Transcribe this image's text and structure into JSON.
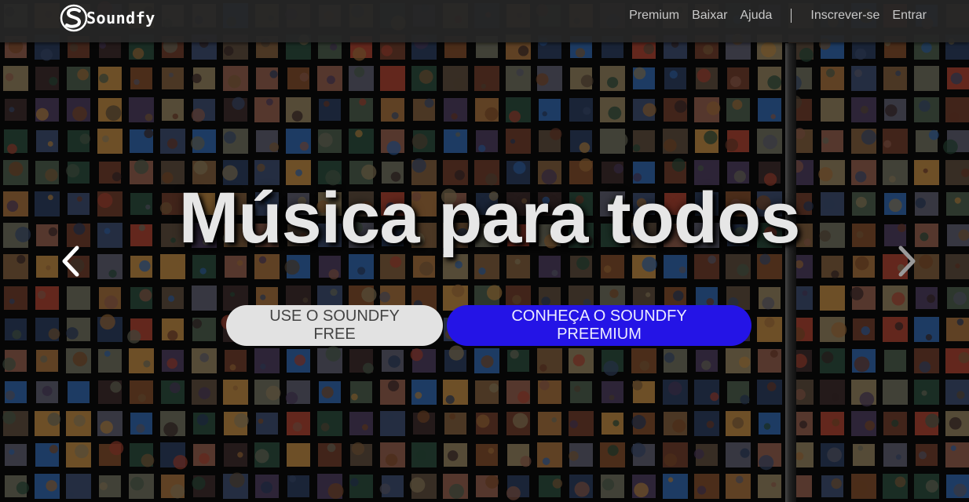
{
  "brand": {
    "name": "Soundfy",
    "logo_icon": "soundfy-s-logo-icon"
  },
  "nav": {
    "links": [
      "Premium",
      "Baixar",
      "Ajuda"
    ],
    "account_links": [
      "Inscrever-se",
      "Entrar"
    ]
  },
  "hero": {
    "title": "Música para todos",
    "free_button": "USE O SOUNDFY FREE",
    "premium_button": "CONHEÇA O SOUNDFY PREEMIUM"
  },
  "carousel": {
    "prev_icon": "chevron-left-icon",
    "next_icon": "chevron-right-icon"
  },
  "colors": {
    "navbar": "#262626",
    "free_button": "#e2e2e2",
    "premium_button": "#2414e6",
    "hero_text": "#e6e6e6"
  }
}
